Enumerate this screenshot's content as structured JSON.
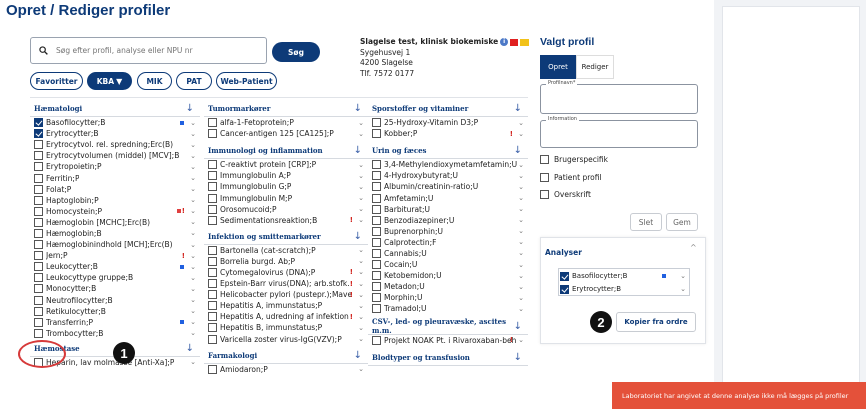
{
  "page_title": "Opret / Rediger profiler",
  "search": {
    "placeholder": "Søg efter profil, analyse eller NPU nr",
    "button": "Søg"
  },
  "filters": [
    {
      "label": "Favoritter",
      "active": false
    },
    {
      "label": "KBA",
      "active": true
    },
    {
      "label": "MIK",
      "active": false
    },
    {
      "label": "PAT",
      "active": false
    },
    {
      "label": "Web-Patient",
      "active": false
    }
  ],
  "lab": {
    "name": "Slagelse test, klinisk biokemiske",
    "address1": "Sygehusvej 1",
    "address2": "4200 Slagelse",
    "phone": "Tlf. 7572 0177"
  },
  "columns": {
    "haematologi": {
      "title": "Hæmatologi",
      "items": [
        {
          "label": "Basofilocytter;B",
          "checked": true,
          "blue": true
        },
        {
          "label": "Erytrocytter;B",
          "checked": true
        },
        {
          "label": "Erytrocytvol. rel. spredning;Erc(B)"
        },
        {
          "label": "Erytrocytvolumen (middel) [MCV];B"
        },
        {
          "label": "Erytropoietin;P"
        },
        {
          "label": "Ferritin;P"
        },
        {
          "label": "Folat;P"
        },
        {
          "label": "Haptoglobin;P"
        },
        {
          "label": "Homocystein;P",
          "redsq": true,
          "warn": true
        },
        {
          "label": "Hæmoglobin [MCHC];Erc(B)"
        },
        {
          "label": "Hæmoglobin;B"
        },
        {
          "label": "Hæmoglobinindhold [MCH];Erc(B)"
        },
        {
          "label": "Jern;P",
          "warn": true
        },
        {
          "label": "Leukocytter;B",
          "blue": true
        },
        {
          "label": "Leukocyttype gruppe;B"
        },
        {
          "label": "Monocytter;B"
        },
        {
          "label": "Neutrofilocytter;B"
        },
        {
          "label": "Retikulocytter;B"
        },
        {
          "label": "Transferrin;P",
          "blue": true
        },
        {
          "label": "Trombocytter;B"
        }
      ],
      "next_title": "Hæmostase",
      "next_items": [
        {
          "label": "Heparin, lav molmasse [Anti-Xa];P"
        }
      ]
    },
    "tumor": {
      "title": "Tumormarkører",
      "items": [
        {
          "label": "alfa-1-Fetoprotein;P"
        },
        {
          "label": "Cancer-antigen 125 [CA125];P"
        }
      ]
    },
    "immuno": {
      "title": "Immunologi og inflammation",
      "items": [
        {
          "label": "C-reaktivt protein [CRP];P"
        },
        {
          "label": "Immunglobulin A;P"
        },
        {
          "label": "Immunglobulin G;P"
        },
        {
          "label": "Immunglobulin M;P"
        },
        {
          "label": "Orosomucoid;P"
        },
        {
          "label": "Sedimentationsreaktion;B",
          "warn": true
        }
      ]
    },
    "infektion": {
      "title": "Infektion og smittemarkører",
      "items": [
        {
          "label": "Bartonella (cat-scratch);P"
        },
        {
          "label": "Borrelia burgd. Ab;P"
        },
        {
          "label": "Cytomegalovirus (DNA);P",
          "warn": true
        },
        {
          "label": "Epstein-Barr virus(DNA); arb.stofk.",
          "warn": true
        },
        {
          "label": "Helicobacter pylori (pustepr.);Mave",
          "warn": true
        },
        {
          "label": "Hepatitis A, immunstatus;P"
        },
        {
          "label": "Hepatitis A, udredning af infektion",
          "warn": true
        },
        {
          "label": "Hepatitis B, immunstatus;P"
        },
        {
          "label": "Varicella zoster virus-IgG(VZV);P"
        }
      ]
    },
    "farmakologi": {
      "title": "Farmakologi",
      "items": [
        {
          "label": "Amiodaron;P"
        }
      ]
    },
    "sporstoffer": {
      "title": "Sporstoffer og vitaminer",
      "items": [
        {
          "label": "25-Hydroxy-Vitamin D3;P"
        },
        {
          "label": "Kobber;P",
          "warn": true
        }
      ]
    },
    "urin": {
      "title": "Urin og fæces",
      "items": [
        {
          "label": "3,4-Methylendioxymetamfetamin;U"
        },
        {
          "label": "4-Hydroxybutyrat;U"
        },
        {
          "label": "Albumin/creatinin-ratio;U"
        },
        {
          "label": "Amfetamin;U"
        },
        {
          "label": "Barbiturat;U"
        },
        {
          "label": "Benzodiazepiner;U"
        },
        {
          "label": "Buprenorphin;U"
        },
        {
          "label": "Calprotectin;F"
        },
        {
          "label": "Cannabis;U"
        },
        {
          "label": "Cocain;U"
        },
        {
          "label": "Ketobemidon;U"
        },
        {
          "label": "Metadon;U"
        },
        {
          "label": "Morphin;U"
        },
        {
          "label": "Tramadol;U"
        }
      ]
    },
    "csv": {
      "title": "CSV-, led- og pleuravæske, ascites m.m.",
      "items": [
        {
          "label": "Projekt NOAK Pt. i Rivaroxaban-beh",
          "warn": true
        }
      ]
    },
    "blod": {
      "title": "Blodtyper og transfusion"
    }
  },
  "profile": {
    "title": "Valgt profil",
    "tabs": [
      "Opret",
      "Rediger"
    ],
    "profilnavn_label": "Profilnavn*",
    "information_label": "Information",
    "options": [
      "Brugerspecifik",
      "Patient profil",
      "Overskrift"
    ],
    "slet": "Slet",
    "gem": "Gem",
    "analyser_title": "Analyser",
    "selected": [
      {
        "label": "Basofilocytter;B",
        "checked": true,
        "blue": true
      },
      {
        "label": "Erytrocytter;B",
        "checked": true
      }
    ],
    "copy_button": "Kopier fra ordre"
  },
  "badges": [
    "1",
    "2"
  ],
  "toast": "Laboratoriet har angivet at denne analyse ikke må lægges på profiler",
  "colors": {
    "primary": "#0d3a78",
    "toast": "#e4513a",
    "circle": "#d63a3a"
  }
}
